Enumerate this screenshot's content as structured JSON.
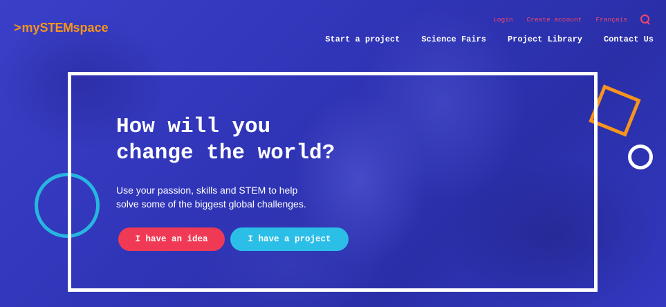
{
  "brand": {
    "prefix": ">",
    "my": "my",
    "stem": "STEM",
    "space": "space",
    "color": "#f7941d"
  },
  "topnav": {
    "login": "Login",
    "create_account": "Create account",
    "language": "Français",
    "search_icon": "search-icon"
  },
  "mainnav": {
    "items": [
      "Start a project",
      "Science Fairs",
      "Project Library",
      "Contact Us"
    ]
  },
  "hero": {
    "headline_line1": "How will you",
    "headline_line2": "change the world?",
    "subtext_line1": "Use your passion, skills and STEM to help",
    "subtext_line2": "solve some of the biggest global challenges.",
    "btn_idea": "I have an idea",
    "btn_project": "I have a project"
  },
  "colors": {
    "background": "#3035b8",
    "accent_red": "#f03a55",
    "accent_cyan": "#2bbfe8",
    "accent_orange": "#f7941d",
    "nav_pink": "#f2476a"
  }
}
